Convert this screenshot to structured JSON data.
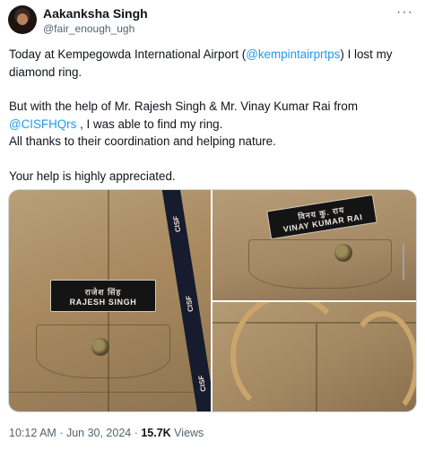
{
  "author": {
    "name": "Aakanksha Singh",
    "handle": "@fair_enough_ugh"
  },
  "menu_icon": "more-horizontal-icon",
  "tweet": {
    "line1_before": "Today at Kempegowda International Airport (",
    "mention1": "@kempintairprtps",
    "line1_after": ") I lost my diamond ring.",
    "line2": "But with the help of Mr. Rajesh Singh & Mr. Vinay Kumar Rai from",
    "mention2": "@CISFHQrs",
    "line3_after": " , I was able to find my ring.",
    "line4": "All thanks to their coordination and helping nature.",
    "line5": "Your help is highly appreciated."
  },
  "media": {
    "photo1": {
      "nameplate_hindi": "राजेश सिंह",
      "nameplate_english": "RAJESH SINGH",
      "lanyard_text": [
        "CISF",
        "CISF",
        "CISF"
      ]
    },
    "photo2": {
      "nameplate_hindi": "विनय कु. राय",
      "nameplate_english": "VINAY KUMAR RAI"
    }
  },
  "meta": {
    "time": "10:12 AM",
    "separator": " · ",
    "date": "Jun 30, 2024",
    "views_count": "15.7K",
    "views_label": " Views"
  }
}
